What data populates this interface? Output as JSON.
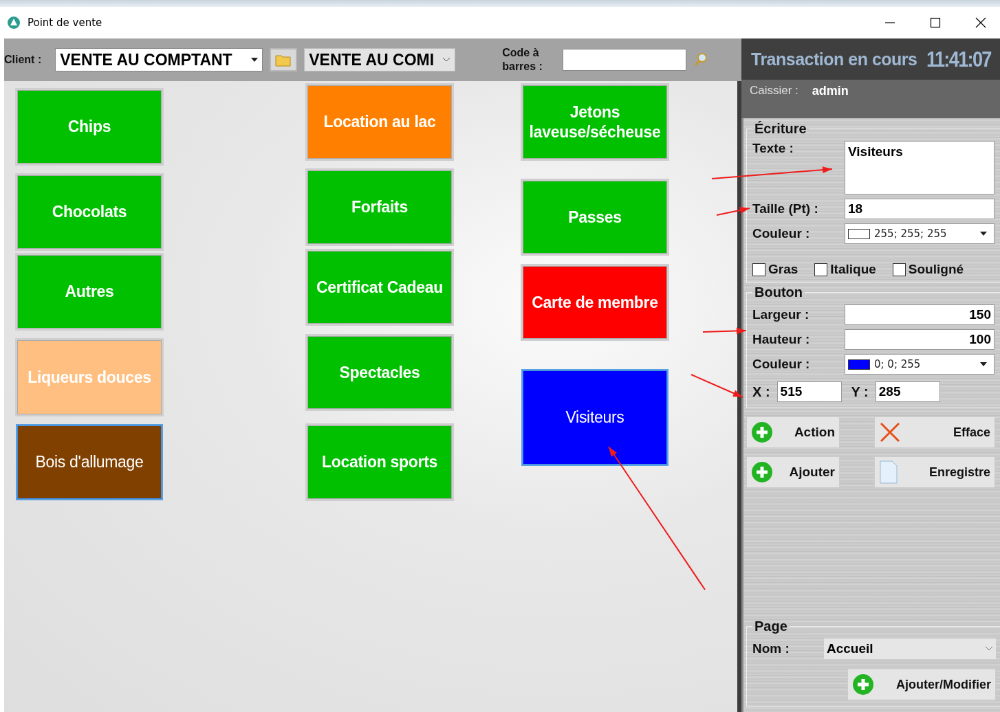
{
  "window": {
    "title": "Point de vente"
  },
  "toolbar": {
    "client_label": "Client :",
    "client_value": "VENTE AU COMPTANT",
    "second_value": "VENTE AU COMI",
    "barcode_label": "Code à barres :"
  },
  "tiles": [
    {
      "label": "Chips",
      "color": "#00c000",
      "selected": false
    },
    {
      "label": "Chocolats",
      "color": "#00c000",
      "selected": false
    },
    {
      "label": "Autres",
      "color": "#00c000",
      "selected": false
    },
    {
      "label": "Liqueurs douces",
      "color": "#ffbf80",
      "selected": false
    },
    {
      "label": "Bois d'allumage",
      "color": "#804000",
      "selected": true
    },
    {
      "label": "Location au lac",
      "color": "#ff8000",
      "selected": false
    },
    {
      "label": "Forfaits",
      "color": "#00c000",
      "selected": false
    },
    {
      "label": "Certificat Cadeau",
      "color": "#00c000",
      "selected": false
    },
    {
      "label": "Spectacles",
      "color": "#00c000",
      "selected": false
    },
    {
      "label": "Location sports",
      "color": "#00c000",
      "selected": false
    },
    {
      "label": "Jetons laveuse/sécheuse",
      "color": "#00c000",
      "selected": false
    },
    {
      "label": "Passes",
      "color": "#00c000",
      "selected": false
    },
    {
      "label": "Carte de membre",
      "color": "#ff0000",
      "selected": false
    },
    {
      "label": "Visiteurs",
      "color": "#0000ff",
      "selected": true
    }
  ],
  "header": {
    "title": "Transaction en cours",
    "time": "11:41:07"
  },
  "cashier": {
    "label": "Caissier :",
    "value": "admin"
  },
  "ecriture": {
    "legend": "Écriture",
    "texte_label": "Texte :",
    "texte_value": "Visiteurs",
    "taille_label": "Taille (Pt) :",
    "taille_value": "18",
    "couleur_label": "Couleur :",
    "couleur_value": "255; 255; 255",
    "color": "#ffffff",
    "checkboxes": [
      {
        "label": "Gras",
        "checked": false
      },
      {
        "label": "Italique",
        "checked": false
      },
      {
        "label": "Souligné",
        "checked": false
      }
    ]
  },
  "bouton": {
    "legend": "Bouton",
    "largeur_label": "Largeur :",
    "largeur_value": "150",
    "hauteur_label": "Hauteur :",
    "hauteur_value": "100",
    "couleur_label": "Couleur :",
    "couleur_value": "0; 0; 255",
    "color": "#0000ff",
    "x_label": "X :",
    "x_value": "515",
    "y_label": "Y :",
    "y_value": "285"
  },
  "actions": [
    {
      "label": "Action",
      "kind": "add"
    },
    {
      "label": "Efface",
      "kind": "delete"
    },
    {
      "label": "Ajouter",
      "kind": "add"
    },
    {
      "label": "Enregistre",
      "kind": "document"
    }
  ],
  "page": {
    "legend": "Page",
    "nom_label": "Nom :",
    "nom_value": "Accueil",
    "button": "Ajouter/Modifier"
  }
}
